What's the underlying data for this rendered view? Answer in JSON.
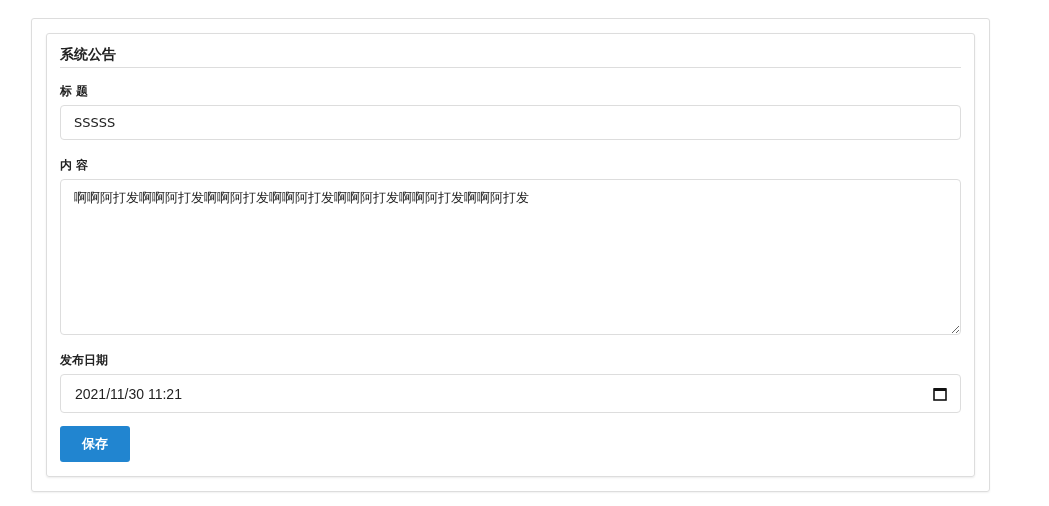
{
  "panel": {
    "title": "系统公告"
  },
  "fields": [
    {
      "kind": "text",
      "label": "标 题",
      "value": "SSSSS"
    },
    {
      "kind": "textarea",
      "label": "内 容",
      "value": "啊啊阿打发啊啊阿打发啊啊阿打发啊啊阿打发啊啊阿打发啊啊阿打发啊啊阿打发"
    },
    {
      "kind": "datetime",
      "label": "发布日期",
      "value": "2021/11/30 11:21"
    }
  ],
  "buttons": [
    "保存"
  ]
}
